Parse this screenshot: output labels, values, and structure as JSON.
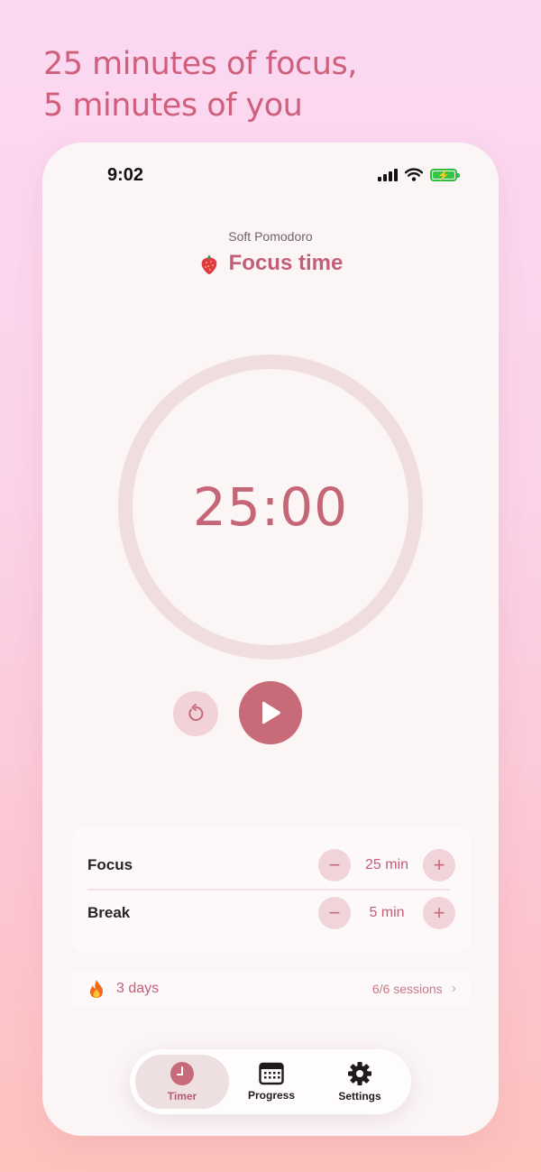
{
  "headline": {
    "line1": "25 minutes of focus,",
    "line2": "5 minutes of you"
  },
  "status_bar": {
    "time": "9:02",
    "icons": [
      "signal-icon",
      "wifi-icon",
      "battery-charging-icon"
    ]
  },
  "header": {
    "app_name": "Soft Pomodoro",
    "mode_icon": "strawberry-icon",
    "mode_title": "Focus time"
  },
  "timer": {
    "display": "25:00",
    "progress": 0
  },
  "controls": {
    "reset_icon": "reset-icon",
    "play_icon": "play-icon"
  },
  "settings": {
    "rows": [
      {
        "label": "Focus",
        "value": "25 min",
        "minus": "−",
        "plus": "+"
      },
      {
        "label": "Break",
        "value": "5 min",
        "minus": "−",
        "plus": "+"
      }
    ]
  },
  "streak": {
    "icon": "fire-icon",
    "days": "3 days",
    "sessions": "6/6 sessions",
    "chevron": "›"
  },
  "tabbar": {
    "tabs": [
      {
        "label": "Timer",
        "icon": "timer-icon",
        "active": true
      },
      {
        "label": "Progress",
        "icon": "calendar-icon",
        "active": false
      },
      {
        "label": "Settings",
        "icon": "gear-icon",
        "active": false
      }
    ]
  },
  "colors": {
    "accent": "#c86b79",
    "accent_text": "#c35e77",
    "ring": "#f0dde0",
    "tint": "#f1d4da"
  }
}
